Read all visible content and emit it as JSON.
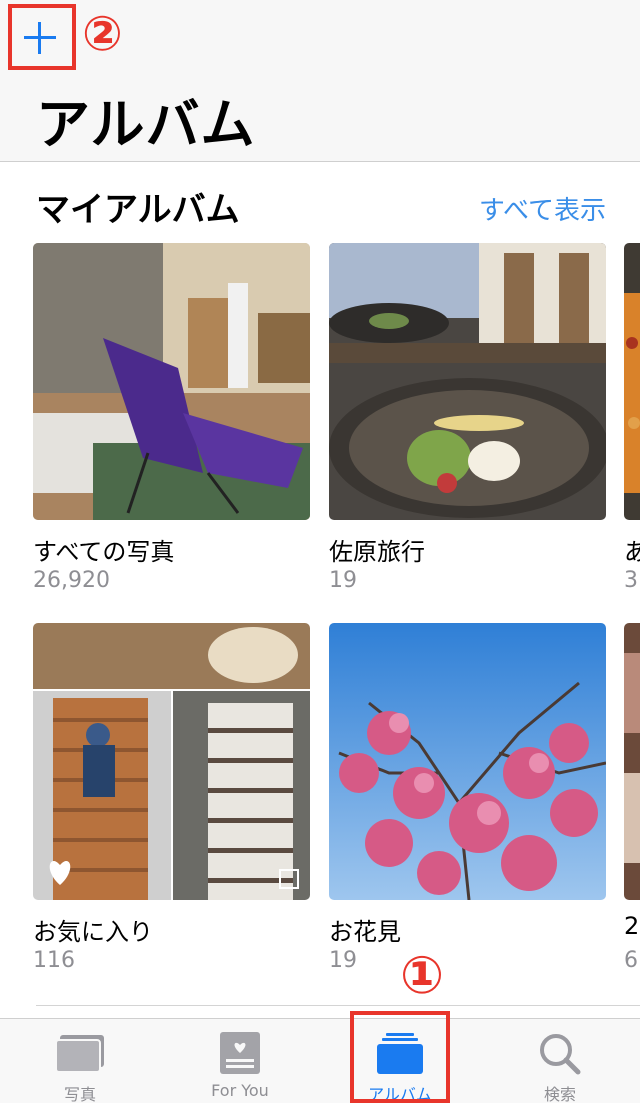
{
  "header": {
    "title": "アルバム",
    "add_icon": "plus-icon"
  },
  "annotations": {
    "marker_1": "①",
    "marker_2": "②",
    "color": "#e8352b"
  },
  "my_albums": {
    "title": "マイアルバム",
    "see_all": "すべて表示",
    "albums": [
      {
        "name": "すべての写真",
        "count": "26,920"
      },
      {
        "name": "佐原旅行",
        "count": "19"
      },
      {
        "name": "あ",
        "count": "3"
      },
      {
        "name": "お気に入り",
        "count": "116"
      },
      {
        "name": "お花見",
        "count": "19"
      },
      {
        "name": "2",
        "count": "6"
      }
    ]
  },
  "tabbar": {
    "tabs": [
      {
        "label": "写真",
        "icon": "photos-icon",
        "active": false
      },
      {
        "label": "For You",
        "icon": "for-you-icon",
        "active": false
      },
      {
        "label": "アルバム",
        "icon": "albums-icon",
        "active": true
      },
      {
        "label": "検索",
        "icon": "search-icon",
        "active": false
      }
    ]
  },
  "colors": {
    "accent": "#1a7bf0",
    "link": "#3a8ee8",
    "secondary_text": "#8e8e93"
  }
}
